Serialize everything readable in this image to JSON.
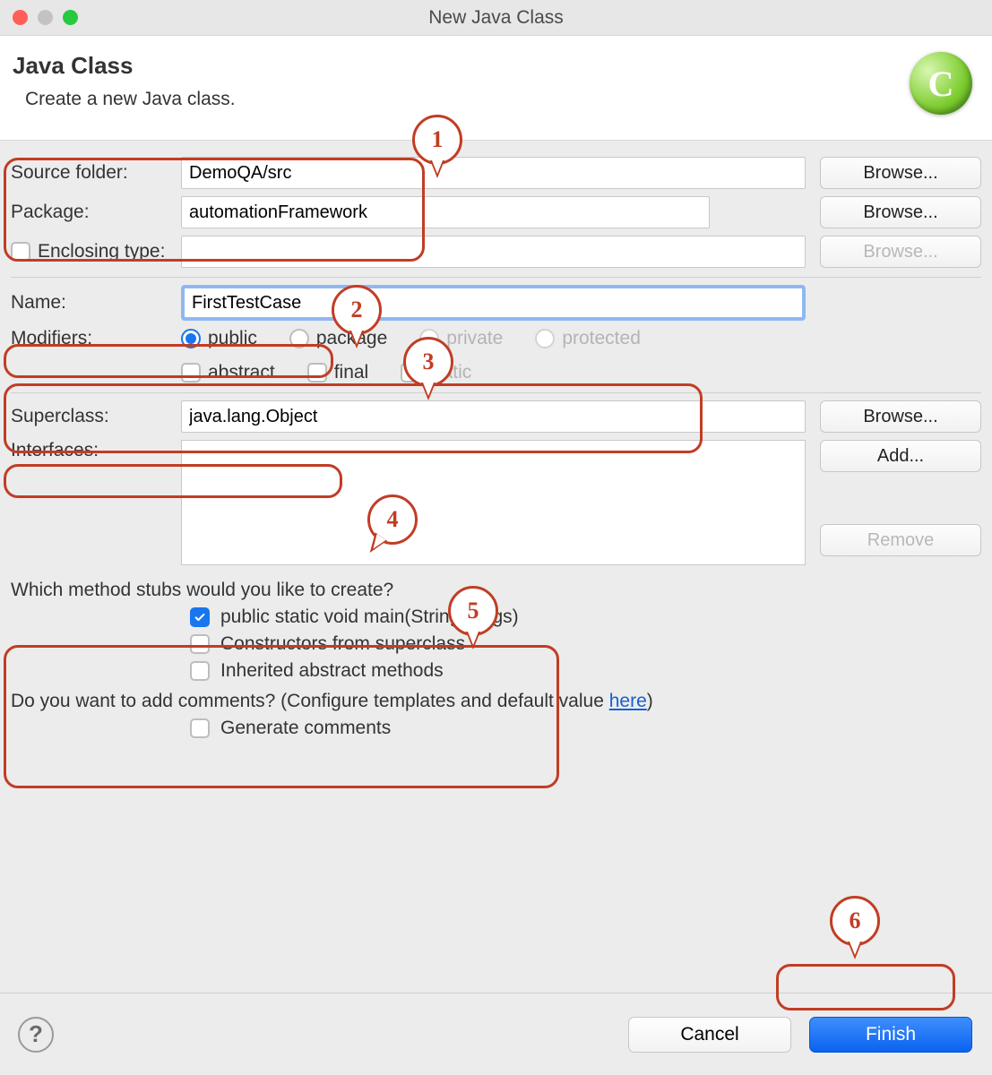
{
  "window": {
    "title": "New Java Class"
  },
  "header": {
    "title": "Java Class",
    "subtitle": "Create a new Java class.",
    "badge_letter": "C"
  },
  "labels": {
    "source_folder": "Source folder:",
    "package": "Package:",
    "enclosing": "Enclosing type:",
    "name": "Name:",
    "modifiers": "Modifiers:",
    "superclass": "Superclass:",
    "interfaces": "Interfaces:",
    "stubs_question": "Which method stubs would you like to create?",
    "comments_question_prefix": "Do you want to add comments? (Configure templates and default value ",
    "here": "here",
    "comments_question_suffix": ")"
  },
  "fields": {
    "source_folder": "DemoQA/src",
    "package": "automationFramework",
    "enclosing": "",
    "name": "FirstTestCase",
    "superclass": "java.lang.Object",
    "interfaces": ""
  },
  "buttons": {
    "browse": "Browse...",
    "add": "Add...",
    "remove": "Remove",
    "cancel": "Cancel",
    "finish": "Finish"
  },
  "modifiers": {
    "access": [
      "public",
      "package",
      "private",
      "protected"
    ],
    "access_selected": "public",
    "access_disabled": [
      "private",
      "protected"
    ],
    "other": [
      "abstract",
      "final",
      "static"
    ],
    "other_disabled": [
      "static"
    ]
  },
  "stubs": {
    "main": {
      "label": "public static void main(String[] args)",
      "checked": true
    },
    "constructors": {
      "label": "Constructors from superclass",
      "checked": false
    },
    "inherited": {
      "label": "Inherited abstract methods",
      "checked": false
    }
  },
  "generate_comments": {
    "label": "Generate comments",
    "checked": false
  },
  "callouts": {
    "1": "1",
    "2": "2",
    "3": "3",
    "4": "4",
    "5": "5",
    "6": "6"
  }
}
